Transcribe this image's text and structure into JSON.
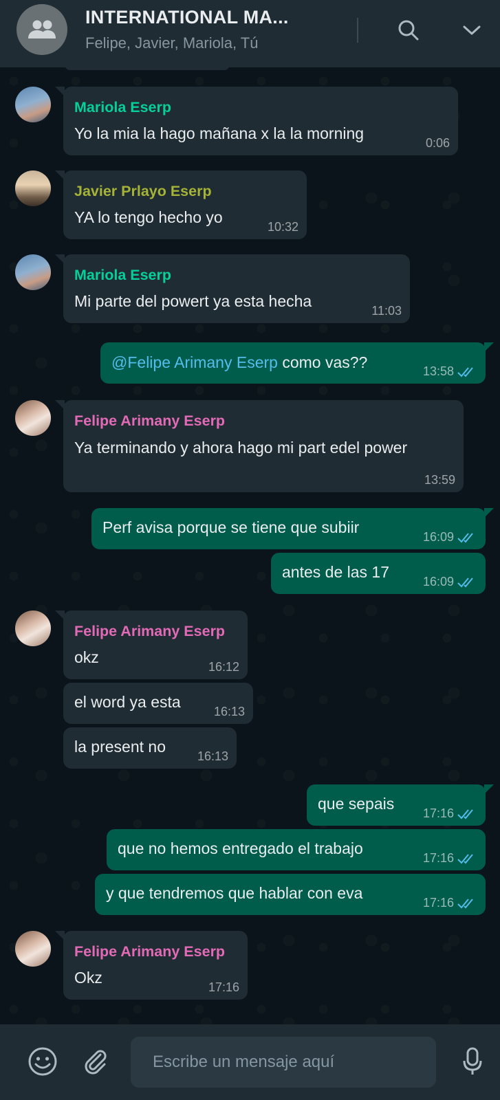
{
  "header": {
    "title": "INTERNATIONAL MA...",
    "participants": "Felipe, Javier, Mariola, Tú"
  },
  "messages": [
    {
      "sender": "Mariola Eserp",
      "sender_color": "#06cf9c",
      "text": "Yo la mia la hago mañana x la la morning",
      "time": "0:06"
    },
    {
      "sender": "Javier Prlayo Eserp",
      "sender_color": "#a5b337",
      "text": "YA lo tengo hecho yo",
      "time": "10:32"
    },
    {
      "sender": "Mariola Eserp",
      "sender_color": "#06cf9c",
      "text": "Mi parte del powert ya esta hecha",
      "time": "11:03"
    },
    {
      "mention": "@Felipe Arimany Eserp",
      "text": " como vas??",
      "time": "13:58",
      "status": "read"
    },
    {
      "sender": "Felipe Arimany Eserp",
      "sender_color": "#e26ab6",
      "text": "Ya terminando y ahora hago mi part edel power",
      "time": "13:59"
    },
    {
      "text": "Perf avisa porque se tiene que subiir",
      "time": "16:09",
      "status": "read"
    },
    {
      "text": "antes de las 17",
      "time": "16:09",
      "status": "read"
    },
    {
      "sender": "Felipe Arimany Eserp",
      "sender_color": "#e26ab6",
      "text": "okz",
      "time": "16:12"
    },
    {
      "text": "el word ya esta",
      "time": "16:13"
    },
    {
      "text": "la present no",
      "time": "16:13"
    },
    {
      "text": "que sepais",
      "time": "17:16",
      "status": "read"
    },
    {
      "text": "que no hemos entregado el trabajo",
      "time": "17:16",
      "status": "read"
    },
    {
      "text": "y que tendremos que hablar con eva",
      "time": "17:16",
      "status": "read"
    },
    {
      "sender": "Felipe Arimany Eserp",
      "sender_color": "#e26ab6",
      "text": "Okz",
      "time": "17:16"
    }
  ],
  "composer": {
    "placeholder": "Escribe un mensaje aquí"
  },
  "colors": {
    "incoming_bubble": "#202c33",
    "outgoing_bubble": "#005c4b",
    "read_ticks": "#53bdeb"
  }
}
